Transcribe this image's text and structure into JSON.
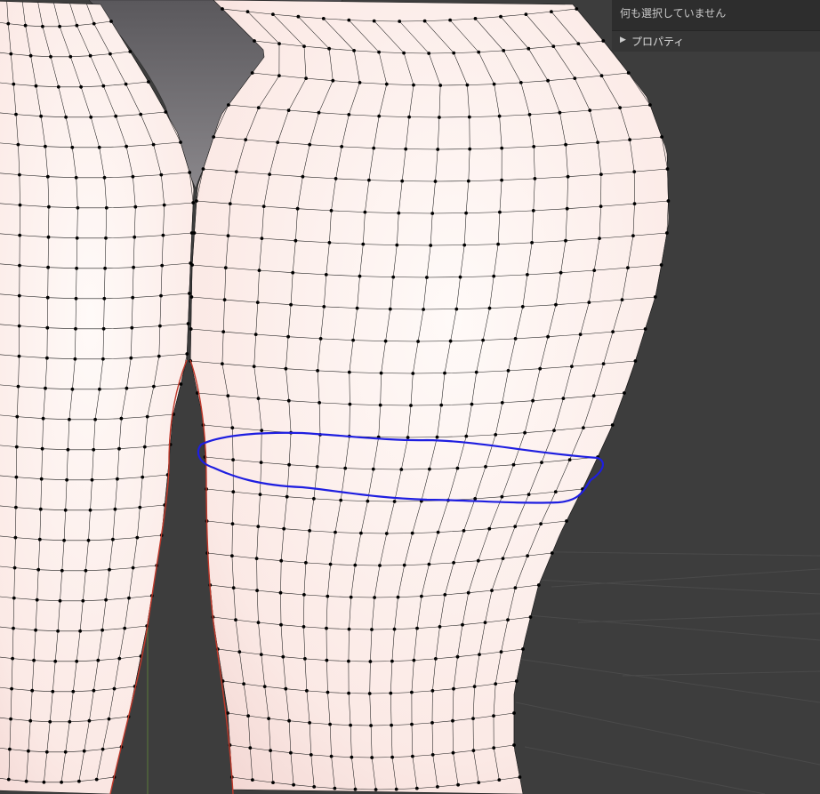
{
  "viewport": {
    "background_color": "#3d3d3d",
    "mesh_fill_color": "#fcefeb",
    "mesh_wire_color": "#1a1a1a",
    "vertex_color": "#000000",
    "selection_loop_color": "#1e1ee0",
    "edge_highlight_color": "#c0392b",
    "garment_color": "#6e6c70"
  },
  "properties_panel": {
    "status_text": "何も選択していません",
    "section_label": "プロパティ",
    "expand_icon": "triangle-right-icon"
  }
}
